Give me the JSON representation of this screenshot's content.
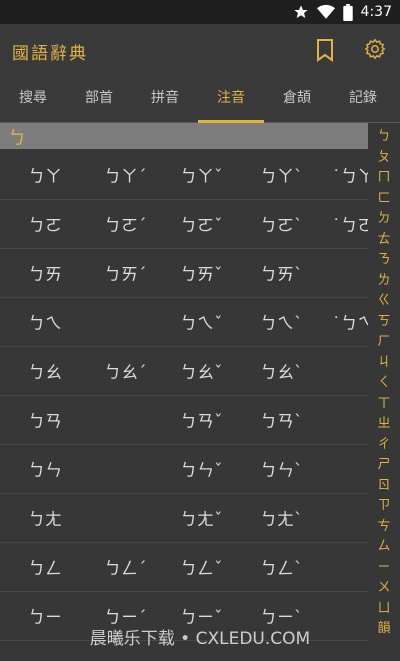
{
  "status_bar": {
    "time": "4:37",
    "icons": [
      "star-icon",
      "wifi-icon",
      "battery-icon"
    ]
  },
  "app": {
    "title": "國語辭典"
  },
  "tabs": [
    "搜尋",
    "部首",
    "拼音",
    "注音",
    "倉頡",
    "記錄"
  ],
  "active_tab": "注音",
  "current_initial": "ㄅ",
  "rows": [
    [
      "ㄅㄚ",
      "ㄅㄚˊ",
      "ㄅㄚˇ",
      "ㄅㄚˋ",
      "˙ㄅㄚ"
    ],
    [
      "ㄅㄛ",
      "ㄅㄛˊ",
      "ㄅㄛˇ",
      "ㄅㄛˋ",
      "˙ㄅㄛ"
    ],
    [
      "ㄅㄞ",
      "ㄅㄞˊ",
      "ㄅㄞˇ",
      "ㄅㄞˋ",
      ""
    ],
    [
      "ㄅㄟ",
      "",
      "ㄅㄟˇ",
      "ㄅㄟˋ",
      "˙ㄅㄟ"
    ],
    [
      "ㄅㄠ",
      "ㄅㄠˊ",
      "ㄅㄠˇ",
      "ㄅㄠˋ",
      ""
    ],
    [
      "ㄅㄢ",
      "",
      "ㄅㄢˇ",
      "ㄅㄢˋ",
      ""
    ],
    [
      "ㄅㄣ",
      "",
      "ㄅㄣˇ",
      "ㄅㄣˋ",
      ""
    ],
    [
      "ㄅㄤ",
      "",
      "ㄅㄤˇ",
      "ㄅㄤˋ",
      ""
    ],
    [
      "ㄅㄥ",
      "ㄅㄥˊ",
      "ㄅㄥˇ",
      "ㄅㄥˋ",
      ""
    ],
    [
      "ㄅㄧ",
      "ㄅㄧˊ",
      "ㄅㄧˇ",
      "ㄅㄧˋ",
      ""
    ]
  ],
  "index": [
    "ㄅ",
    "ㄆ",
    "ㄇ",
    "ㄈ",
    "ㄉ",
    "ㄊ",
    "ㄋ",
    "ㄌ",
    "ㄍ",
    "ㄎ",
    "ㄏ",
    "ㄐ",
    "ㄑ",
    "ㄒ",
    "ㄓ",
    "ㄔ",
    "ㄕ",
    "ㄖ",
    "ㄗ",
    "ㄘ",
    "ㄙ",
    "ㄧ",
    "ㄨ",
    "ㄩ",
    "韻"
  ],
  "watermark": "晨曦乐下载 • CXLEDU.COM",
  "colors": {
    "accent": "#e0b24a",
    "background": "#373737",
    "header_bar": "#7d7d7d"
  }
}
